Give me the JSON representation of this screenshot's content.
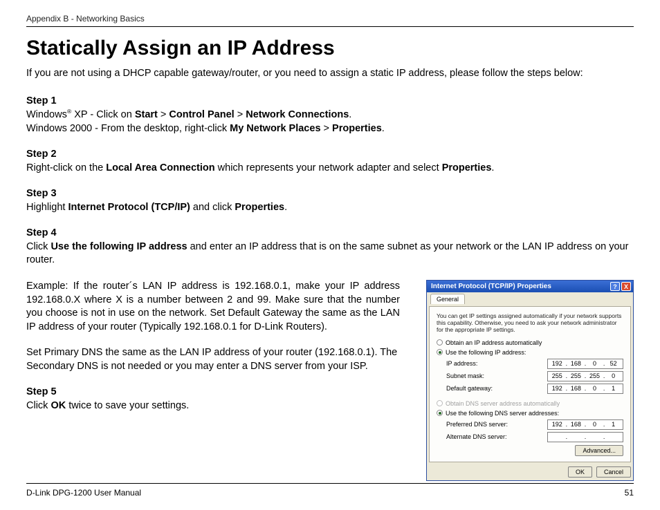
{
  "header": "Appendix B - Networking Basics",
  "title": "Statically Assign an IP Address",
  "intro": "If you are not using a DHCP capable gateway/router, or you need to assign a static IP address, please follow the steps below:",
  "steps": {
    "s1": {
      "label": "Step 1",
      "line1a": "Windows",
      "line1b": " XP - Click on ",
      "b1": "Start",
      "gt1": " > ",
      "b2": "Control Panel",
      "gt2": " > ",
      "b3": "Network Connections",
      "end1": ".",
      "line2a": "Windows 2000 - From the desktop, right-click ",
      "b4": "My Network Places",
      "gt3": " > ",
      "b5": "Properties",
      "end2": "."
    },
    "s2": {
      "label": "Step 2",
      "a": "Right-click on the ",
      "b1": "Local Area Connection",
      "b": " which represents your network adapter and select ",
      "b2": "Properties",
      "end": "."
    },
    "s3": {
      "label": "Step 3",
      "a": "Highlight ",
      "b1": "Internet Protocol (TCP/IP)",
      "b": " and click ",
      "b2": "Properties",
      "end": "."
    },
    "s4": {
      "label": "Step 4",
      "a": "Click ",
      "b1": "Use the following IP address",
      "b": " and enter an IP address that is on the same subnet as your network or the LAN IP address on your router.",
      "example": "Example: If the router´s LAN IP address is 192.168.0.1, make your IP address 192.168.0.X where X is a number between 2 and 99. Make sure that the number you choose is not in use on the network. Set Default Gateway the same as the LAN IP address of your router (Typically 192.168.0.1 for D-Link Routers).",
      "dns": "Set Primary DNS the same as the LAN IP address of your router (192.168.0.1). The Secondary DNS is not needed or you may enter a DNS server from your ISP."
    },
    "s5": {
      "label": "Step 5",
      "a": "Click ",
      "b1": "OK",
      "b": " twice to save your settings."
    }
  },
  "dialog": {
    "title": "Internet Protocol (TCP/IP) Properties",
    "help": "?",
    "close": "X",
    "tab": "General",
    "desc": "You can get IP settings assigned automatically if your network supports this capability. Otherwise, you need to ask your network administrator for the appropriate IP settings.",
    "radio_auto_ip": "Obtain an IP address automatically",
    "radio_use_ip": "Use the following IP address:",
    "lbl_ip": "IP address:",
    "lbl_subnet": "Subnet mask:",
    "lbl_gateway": "Default gateway:",
    "ip": [
      "192",
      "168",
      "0",
      "52"
    ],
    "subnet": [
      "255",
      "255",
      "255",
      "0"
    ],
    "gateway": [
      "192",
      "168",
      "0",
      "1"
    ],
    "radio_auto_dns": "Obtain DNS server address automatically",
    "radio_use_dns": "Use the following DNS server addresses:",
    "lbl_pref_dns": "Preferred DNS server:",
    "lbl_alt_dns": "Alternate DNS server:",
    "pref_dns": [
      "192",
      "168",
      "0",
      "1"
    ],
    "btn_advanced": "Advanced...",
    "btn_ok": "OK",
    "btn_cancel": "Cancel"
  },
  "footer": {
    "left": "D-Link DPG-1200 User Manual",
    "right": "51"
  }
}
